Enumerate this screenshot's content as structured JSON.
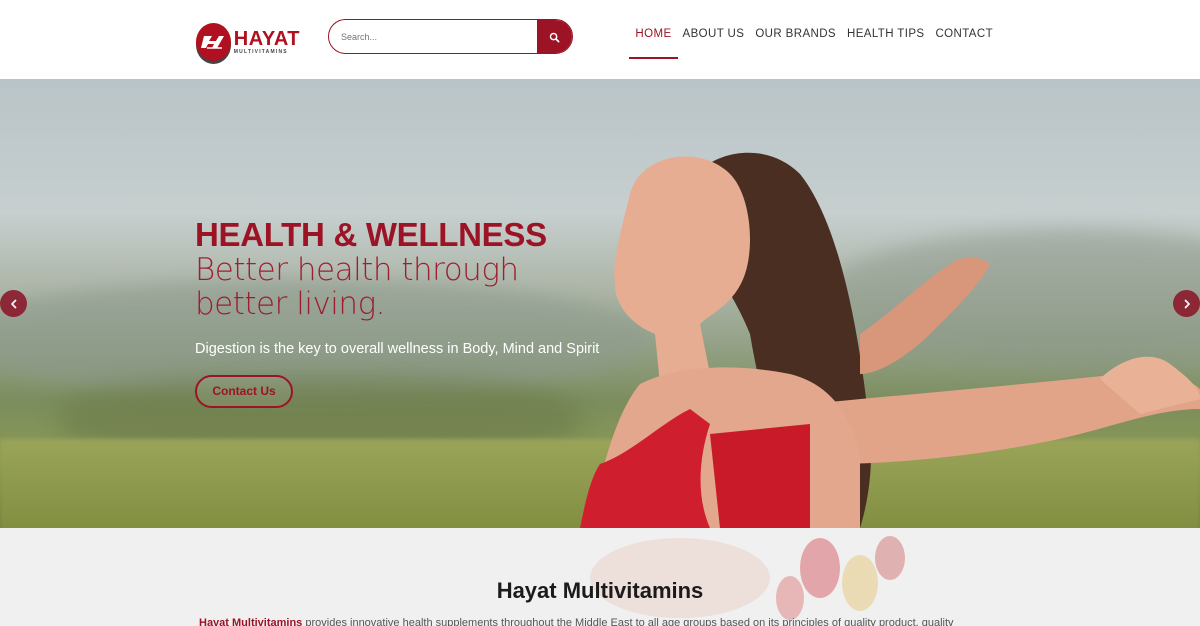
{
  "brand": {
    "logo_word": "HAYAT",
    "logo_sub": "MULTIVITAMINS"
  },
  "search": {
    "placeholder": "Search..."
  },
  "nav": {
    "items": [
      {
        "label": "HOME"
      },
      {
        "label": "ABOUT US"
      },
      {
        "label": "OUR BRANDS"
      },
      {
        "label": "HEALTH TIPS"
      },
      {
        "label": "CONTACT"
      }
    ],
    "active_item": "HOME"
  },
  "hero": {
    "title": "HEALTH & WELLNESS",
    "subtitle": "Better health through better living.",
    "description": "Digestion is the key to overall wellness in Body, Mind and Spirit",
    "button_label": "Contact Us"
  },
  "intro": {
    "title": "Hayat Multivitamins",
    "brand_link": "Hayat Multivitamins",
    "text": " provides innovative health supplements throughout the Middle East to all age groups based on its principles of quality product, quality"
  },
  "colors": {
    "accent": "#9c1325",
    "intro_bg": "#f0f0f0"
  },
  "icons": {
    "search": "search-icon",
    "prev": "chevron-left-icon",
    "next": "chevron-right-icon"
  }
}
